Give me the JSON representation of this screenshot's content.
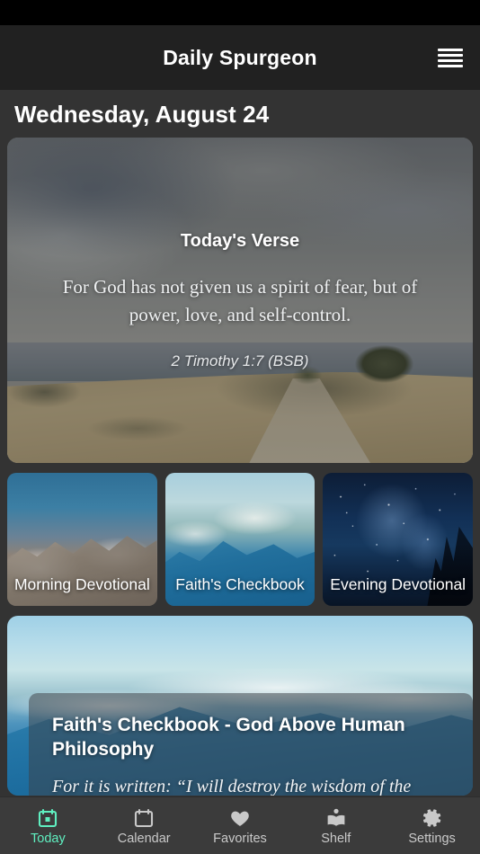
{
  "theme": {
    "accent": "#5fefc0",
    "page_bg": "#333333",
    "header_bg": "#212121",
    "nav_bg": "#3b3b3b",
    "text": "#ffffff",
    "muted_text": "#c9c9c9"
  },
  "header": {
    "title": "Daily Spurgeon",
    "menu_icon": "hamburger-menu-icon"
  },
  "main": {
    "date_heading": "Wednesday, August 24",
    "hero": {
      "label": "Today's Verse",
      "verse": "For God has not given us a spirit of fear, but of power, love, and self-control.",
      "reference": "2 Timothy 1:7 (BSB)"
    },
    "tiles": [
      {
        "label": "Morning Devotional",
        "image": "snow-capped-mountains"
      },
      {
        "label": "Faith's Checkbook",
        "image": "aerial-clouds-over-mountains"
      },
      {
        "label": "Evening Devotional",
        "image": "starry-night-sky-with-trees"
      }
    ],
    "feature": {
      "title": "Faith's Checkbook - God Above Human Philosophy",
      "excerpt": "For it is written: “I will destroy the wisdom of the",
      "image": "aerial-clouds-over-mountains"
    }
  },
  "bottom_nav": {
    "items": [
      {
        "label": "Today",
        "icon": "calendar-today-icon",
        "active": true
      },
      {
        "label": "Calendar",
        "icon": "calendar-icon",
        "active": false
      },
      {
        "label": "Favorites",
        "icon": "heart-icon",
        "active": false
      },
      {
        "label": "Shelf",
        "icon": "book-reader-icon",
        "active": false
      },
      {
        "label": "Settings",
        "icon": "gear-icon",
        "active": false
      }
    ]
  }
}
